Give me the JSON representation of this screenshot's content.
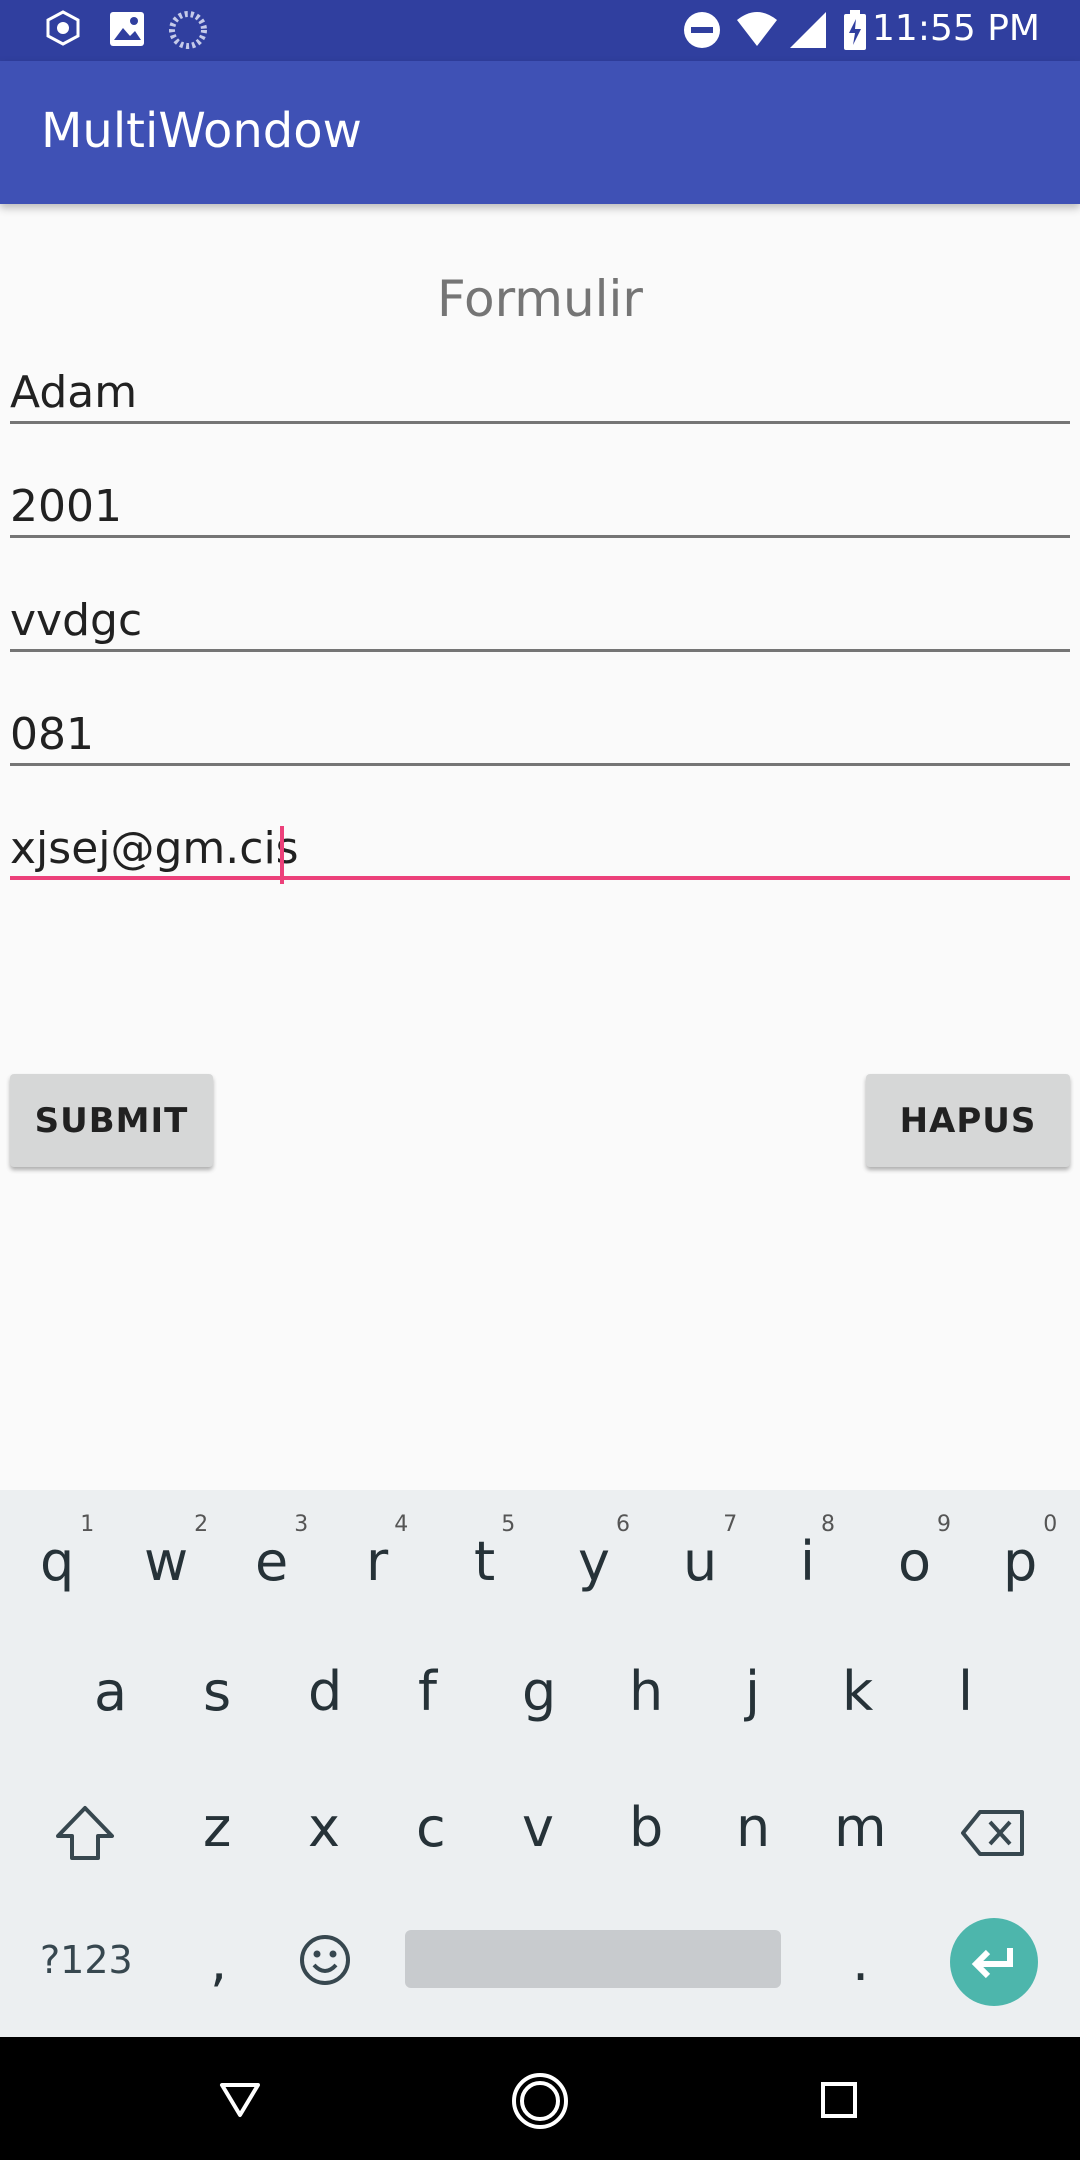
{
  "status_bar": {
    "time": "11:55 PM"
  },
  "app": {
    "title": "MultiWondow"
  },
  "form": {
    "title": "Formulir",
    "fields": [
      {
        "value": "Adam"
      },
      {
        "value": "2001"
      },
      {
        "value": "vvdgc"
      },
      {
        "value": "081"
      },
      {
        "value": "xjsej@gm.cis"
      }
    ],
    "submit_label": "SUBMIT",
    "clear_label": "HAPUS"
  },
  "keyboard": {
    "row1": [
      "q",
      "w",
      "e",
      "r",
      "t",
      "y",
      "u",
      "i",
      "o",
      "p"
    ],
    "row1_hints": [
      "1",
      "2",
      "3",
      "4",
      "5",
      "6",
      "7",
      "8",
      "9",
      "0"
    ],
    "row2": [
      "a",
      "s",
      "d",
      "f",
      "g",
      "h",
      "j",
      "k",
      "l"
    ],
    "row3": [
      "z",
      "x",
      "c",
      "v",
      "b",
      "n",
      "m"
    ],
    "symbols_label": "?123",
    "comma": ",",
    "period": "."
  },
  "colors": {
    "status_bar": "#303f9f",
    "app_bar": "#3f51b5",
    "accent": "#ec407a",
    "enter_key": "#4db6ac"
  }
}
